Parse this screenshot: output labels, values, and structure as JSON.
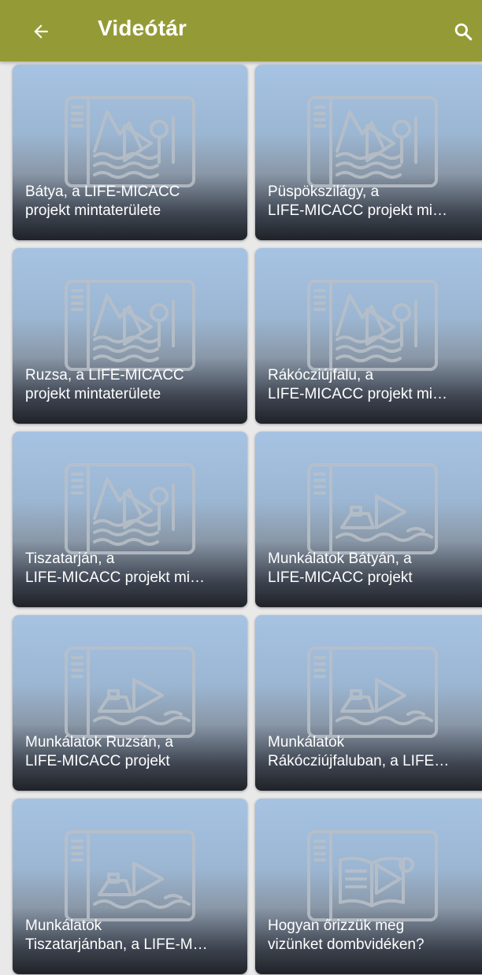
{
  "appbar": {
    "title": "Videótár",
    "back_icon": "arrow-left-icon",
    "search_icon": "search-icon",
    "color": "#949b36"
  },
  "videos": [
    {
      "line1": "Bátya, a LIFE-MICACC",
      "line2": "projekt mintaterülete",
      "thumb": "landscape"
    },
    {
      "line1": "Püspökszilágy, a",
      "line2": "LIFE-MICACC projekt mi…",
      "thumb": "landscape"
    },
    {
      "line1": "Ruzsa, a LIFE-MICACC",
      "line2": "projekt mintaterülete",
      "thumb": "landscape"
    },
    {
      "line1": "Rákócziújfalu, a",
      "line2": "LIFE-MICACC projekt mi…",
      "thumb": "landscape"
    },
    {
      "line1": "Tiszatarján, a",
      "line2": "LIFE-MICACC projekt mi…",
      "thumb": "landscape"
    },
    {
      "line1": "Munkálatok Bátyán, a",
      "line2": "LIFE-MICACC projekt",
      "thumb": "boat"
    },
    {
      "line1": "Munkálatok Ruzsán, a",
      "line2": "LIFE-MICACC projekt",
      "thumb": "boat"
    },
    {
      "line1": "Munkálatok",
      "line2": "Rákócziújfaluban, a LIFE…",
      "thumb": "boat"
    },
    {
      "line1": "Munkálatok",
      "line2": "Tiszatarjánban, a LIFE-M…",
      "thumb": "boat"
    },
    {
      "line1": "Hogyan őrizzük meg",
      "line2": "vizünket dombvidéken?",
      "thumb": "book"
    }
  ]
}
